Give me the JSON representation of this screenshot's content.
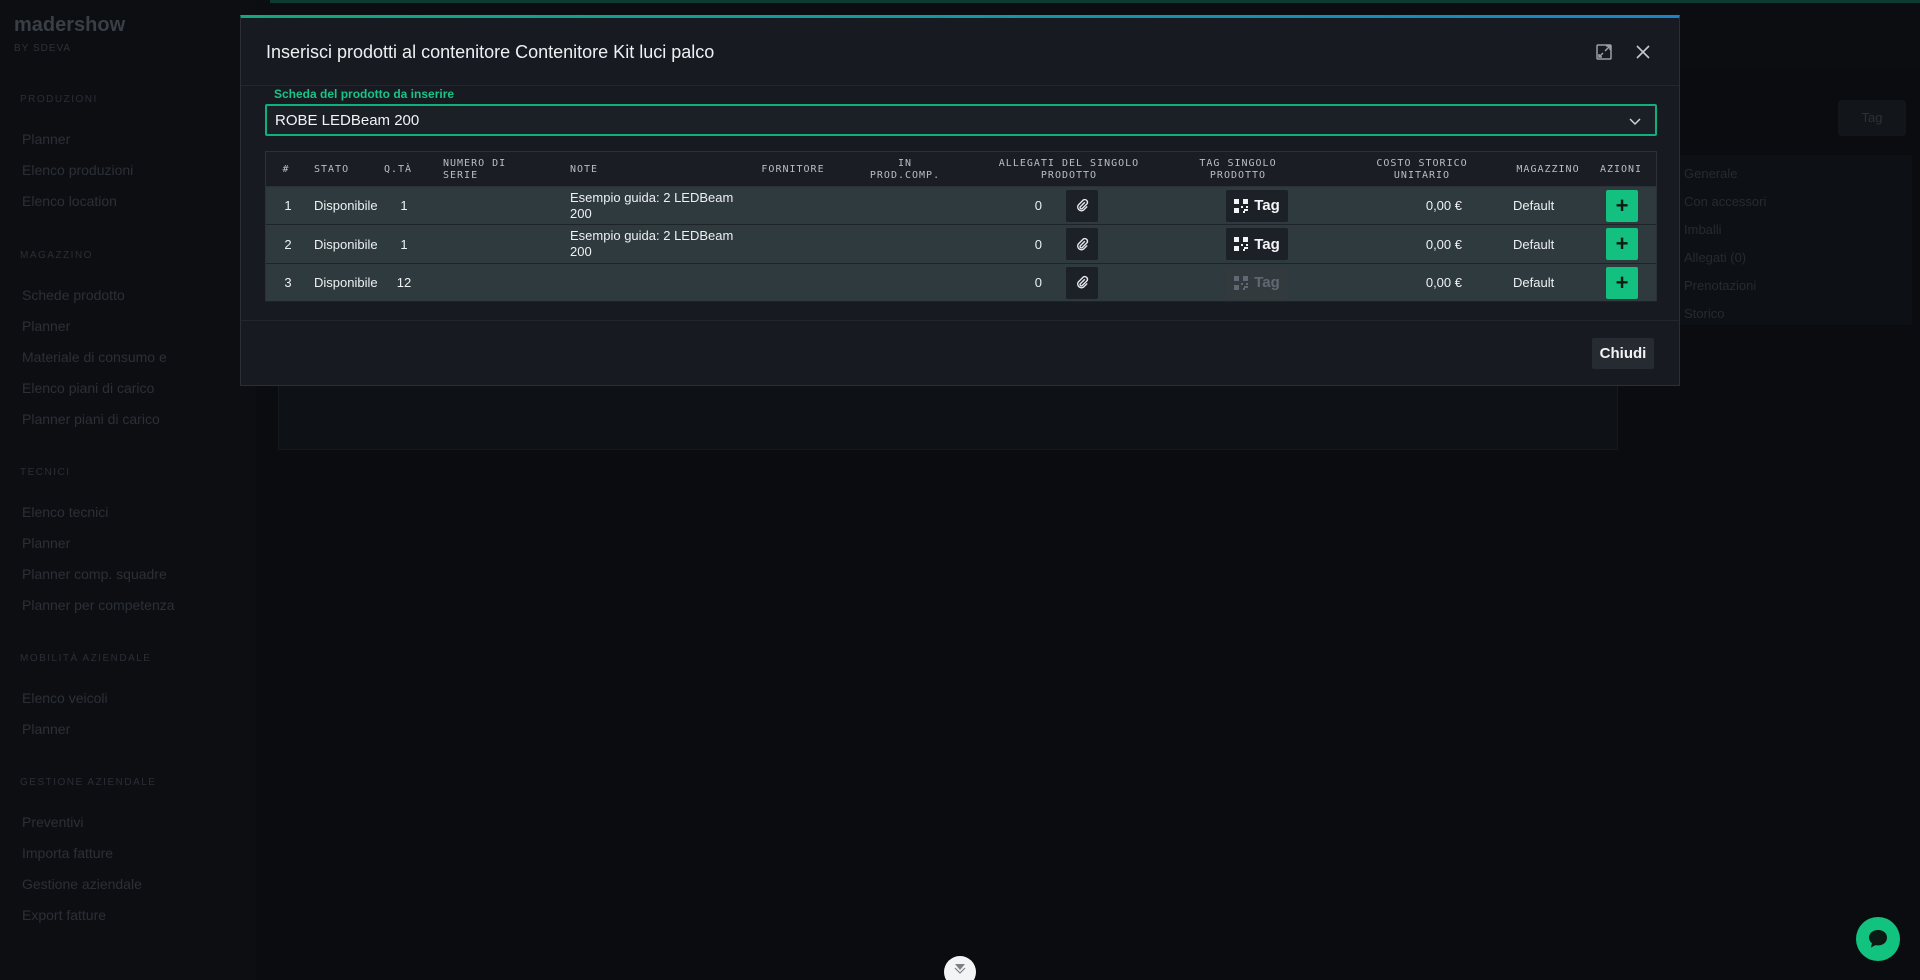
{
  "background": {
    "logo": "madershow",
    "logo_sub": "BY SDEVA",
    "sections": [
      {
        "title": "Produzioni",
        "items": [
          "Planner",
          "Elenco produzioni",
          "Elenco location"
        ]
      },
      {
        "title": "Magazzino",
        "items": [
          "Schede prodotto",
          "Planner",
          "Materiale di consumo e",
          "Elenco piani di carico",
          "Planner piani di carico"
        ]
      },
      {
        "title": "Tecnici",
        "items": [
          "Elenco tecnici",
          "Planner",
          "Planner comp. squadre",
          "Planner per competenza"
        ]
      },
      {
        "title": "Mobilità aziendale",
        "items": [
          "Elenco veicoli",
          "Planner"
        ]
      },
      {
        "title": "Gestione aziendale",
        "items": [
          "Preventivi",
          "Importa fatture",
          "Gestione aziendale",
          "Export fatture"
        ]
      }
    ],
    "right_items": [
      "Generale",
      "Con accessori",
      "Imballi",
      "Allegati (0)",
      "Prenotazioni",
      "Storico"
    ],
    "tag_button": "Tag"
  },
  "modal": {
    "title": "Inserisci prodotti al contenitore Contenitore Kit luci palco",
    "field_label": "Scheda del prodotto da inserire",
    "selected_product": "ROBE LEDBeam 200",
    "columns": [
      "#",
      "Stato",
      "Q.tà",
      "Numero di serie",
      "Note",
      "Fornitore",
      "In prod.comp.",
      "Allegati del singolo prodotto",
      "Tag singolo prodotto",
      "Costo storico unitario",
      "Magazzino",
      "Azioni"
    ],
    "rows": [
      {
        "num": "1",
        "stato": "Disponibile",
        "qta": "1",
        "serie": "",
        "note": "Esempio guida: 2 LEDBeam 200",
        "fornitore": "",
        "inprod": "",
        "allegati": "0",
        "tag": "Tag",
        "tag_enabled": true,
        "costo": "0,00 €",
        "magazzino": "Default"
      },
      {
        "num": "2",
        "stato": "Disponibile",
        "qta": "1",
        "serie": "",
        "note": "Esempio guida: 2 LEDBeam 200",
        "fornitore": "",
        "inprod": "",
        "allegati": "0",
        "tag": "Tag",
        "tag_enabled": true,
        "costo": "0,00 €",
        "magazzino": "Default"
      },
      {
        "num": "3",
        "stato": "Disponibile",
        "qta": "12",
        "serie": "",
        "note": "",
        "fornitore": "",
        "inprod": "",
        "allegati": "0",
        "tag": "Tag",
        "tag_enabled": false,
        "costo": "0,00 €",
        "magazzino": "Default"
      }
    ],
    "close_label": "Chiudi"
  },
  "colors": {
    "accent": "#13c07f",
    "row_bg": "#2e3a3d",
    "modal_bg": "#171a20"
  }
}
